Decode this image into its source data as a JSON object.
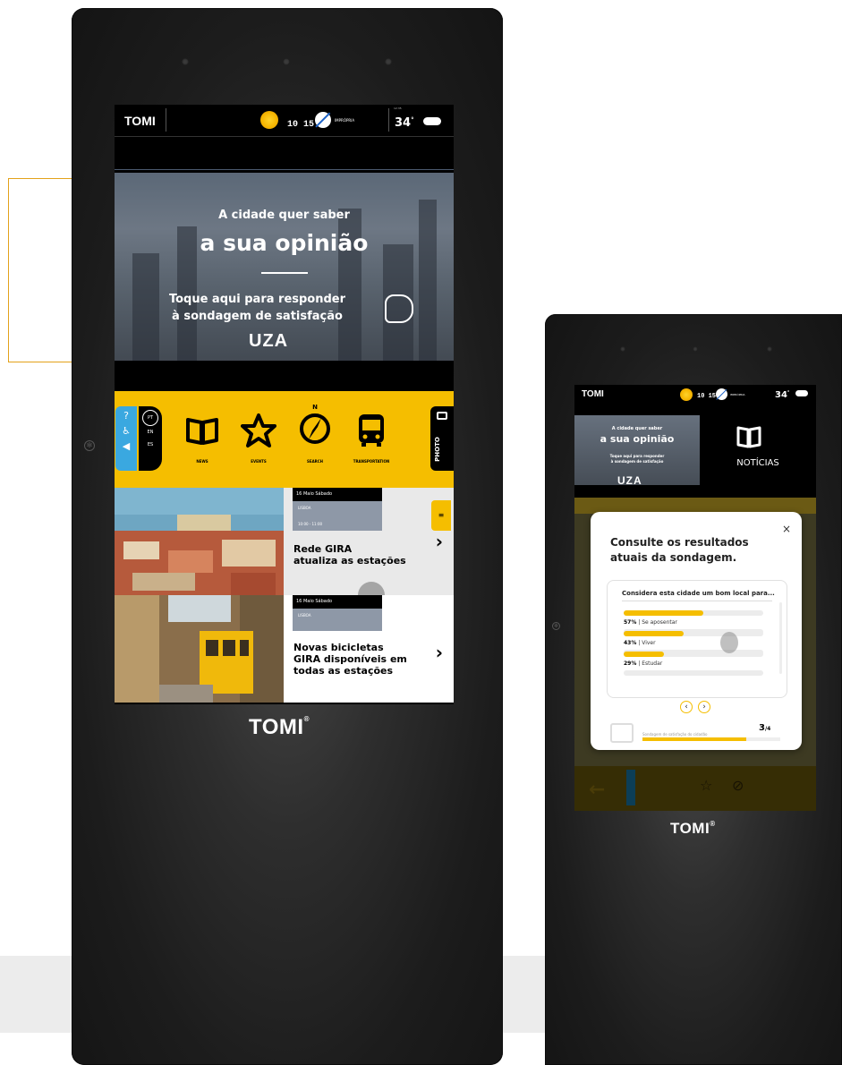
{
  "kiosk1": {
    "brand": "TOMI",
    "reg": "®",
    "screen": {
      "logo": "TOMI",
      "weather": {
        "nums": "10 15",
        "status": "IMPRÓPRIA",
        "temp": "34",
        "deg": "°",
        "time": "12:35"
      },
      "hero": {
        "line1": "A cidade quer saber",
        "line2": "a sua opinião",
        "line3": "Toque aqui para responder",
        "line4": "à sondagem de satisfação",
        "sponsor": "UZA"
      },
      "languages": [
        "PT",
        "EN",
        "ES"
      ],
      "nav": [
        {
          "label": "NEWS",
          "icon": "book-icon"
        },
        {
          "label": "EVENTS",
          "icon": "star-icon"
        },
        {
          "label": "SEARCH",
          "icon": "compass-icon"
        },
        {
          "label": "TRANSPORTATION",
          "icon": "bus-icon"
        }
      ],
      "photo_label": "PHOTO",
      "compass_n": "N",
      "news": [
        {
          "date": "16 Maio Sábado",
          "place": "LISBOA",
          "time": "10:00 - 11:00",
          "title_1": "Rede GIRA",
          "title_2": "atualiza as estações",
          "title_3": ""
        },
        {
          "date": "16 Maio Sábado",
          "place": "LISBOA",
          "time": "",
          "title_1": "Novas bicicletas",
          "title_2": "GIRA disponíveis em",
          "title_3": "todas as estações"
        }
      ]
    }
  },
  "kiosk2": {
    "brand": "TOMI",
    "reg": "®",
    "screen": {
      "logo": "TOMI",
      "weather": {
        "nums": "10 15",
        "status": "IMPRÓPRIA",
        "temp": "34",
        "deg": "°"
      },
      "hero": {
        "line1": "A cidade quer saber",
        "line2": "a sua opinião",
        "line3": "Toque aqui para responder",
        "line4": "à sondagem de satisfação",
        "sponsor": "UZA"
      },
      "news_label": "NOTÍCIAS"
    },
    "modal": {
      "title": "Consulte os resultados atuais da sondagem.",
      "close": "×",
      "question": "Considera esta cidade um bom local para...",
      "results": [
        {
          "pct": "57%",
          "label": "Se aposentar",
          "value": 0.57
        },
        {
          "pct": "43%",
          "label": "Viver",
          "value": 0.43
        },
        {
          "pct": "29%",
          "label": "Estudar",
          "value": 0.29
        }
      ],
      "prev": "‹",
      "next": "›",
      "footer": "Sondagem de satisfação do cidadão",
      "count": "3",
      "total": "/4",
      "progress": 0.75
    }
  }
}
